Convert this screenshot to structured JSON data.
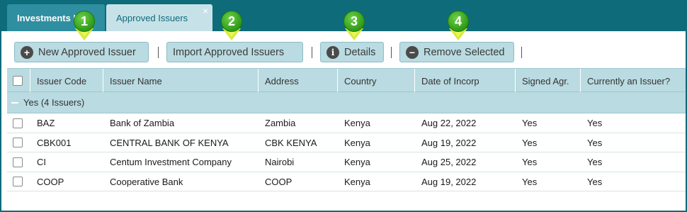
{
  "tabs": [
    {
      "label": "Investments I"
    },
    {
      "label": "Approved Issuers",
      "close": "×"
    }
  ],
  "toolbar": {
    "new_label": "New Approved Issuer",
    "import_label": "Import Approved Issuers",
    "details_label": "Details",
    "remove_label": "Remove Selected",
    "icons": {
      "new": "plus-circle-icon",
      "details": "info-icon",
      "remove": "minus-circle-icon"
    }
  },
  "callouts": [
    "1",
    "2",
    "3",
    "4"
  ],
  "grid": {
    "columns": [
      "Issuer Code",
      "Issuer Name",
      "Address",
      "Country",
      "Date of Incorp",
      "Signed Agr.",
      "Currently an Issuer?"
    ],
    "group_label": "Yes (4 Issuers)",
    "rows": [
      {
        "code": "BAZ",
        "name": "Bank of Zambia",
        "address": "Zambia",
        "country": "Kenya",
        "date": "Aug 22, 2022",
        "signed": "Yes",
        "current": "Yes"
      },
      {
        "code": "CBK001",
        "name": "CENTRAL BANK OF KENYA",
        "address": "CBK KENYA",
        "country": "Kenya",
        "date": "Aug 19, 2022",
        "signed": "Yes",
        "current": "Yes"
      },
      {
        "code": "CI",
        "name": "Centum Investment Company",
        "address": "Nairobi",
        "country": "Kenya",
        "date": "Aug 25, 2022",
        "signed": "Yes",
        "current": "Yes"
      },
      {
        "code": "COOP",
        "name": "Cooperative Bank",
        "address": "COOP",
        "country": "Kenya",
        "date": "Aug 19, 2022",
        "signed": "Yes",
        "current": "Yes"
      }
    ]
  },
  "colors": {
    "teal": "#0e6b7a",
    "header": "#b9dbe1",
    "callout": "#2e9a17",
    "arrow": "#d8e93a"
  }
}
